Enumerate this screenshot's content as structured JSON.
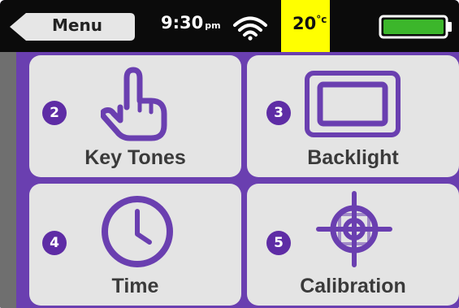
{
  "status_bar": {
    "menu_label": "Menu",
    "time": "9:30",
    "ampm": "pm",
    "temperature": "20",
    "temperature_unit": "°c",
    "battery_level": 1.0,
    "colors": {
      "bar": "#0b0b0b",
      "temp_highlight": "#ffff00",
      "battery_fill": "#3cb62b"
    }
  },
  "tiles": [
    {
      "number": "2",
      "label": "Key Tones",
      "icon": "touch-hand-icon"
    },
    {
      "number": "3",
      "label": "Backlight",
      "icon": "backlight-screen-icon"
    },
    {
      "number": "4",
      "label": "Time",
      "icon": "clock-icon"
    },
    {
      "number": "5",
      "label": "Calibration",
      "icon": "crosshair-target-icon"
    }
  ],
  "theme": {
    "accent": "#6a3fb0",
    "tile_background": "#e4e4e4",
    "badge": "#5e2ca5"
  }
}
